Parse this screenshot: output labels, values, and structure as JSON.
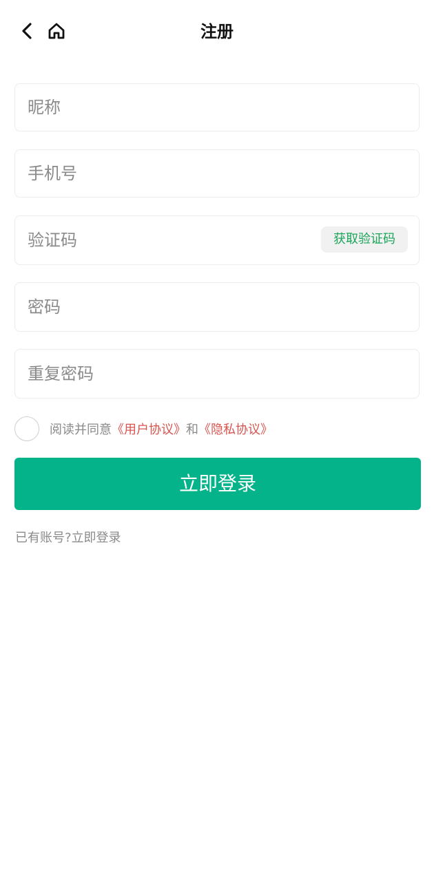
{
  "header": {
    "title": "注册",
    "back_icon": "chevron-left-icon",
    "home_icon": "home-icon"
  },
  "form": {
    "nickname_placeholder": "昵称",
    "phone_placeholder": "手机号",
    "code_placeholder": "验证码",
    "get_code_label": "获取验证码",
    "password_placeholder": "密码",
    "repeat_password_placeholder": "重复密码"
  },
  "agreement": {
    "prefix": "阅读并同意",
    "user_agreement": "《用户协议》",
    "conjunction": "和",
    "privacy_agreement": "《隐私协议》",
    "checked": false
  },
  "submit_label": "立即登录",
  "footer": {
    "have_account": "已有账号?",
    "login_link": "立即登录"
  },
  "colors": {
    "primary": "#04b38a",
    "link": "#d9534f",
    "code_text": "#1aa55a"
  }
}
